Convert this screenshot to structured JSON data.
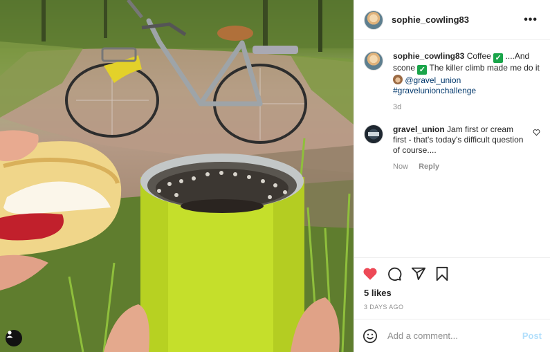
{
  "header": {
    "username": "sophie_cowling83",
    "more_label": "•••"
  },
  "caption": {
    "username": "sophie_cowling83",
    "text_1": "Coffee",
    "text_2": "....And scone",
    "text_3": "The killer climb made me do it",
    "mention": "@gravel_union",
    "hashtag": "#gravelunionchallenge",
    "time": "3d"
  },
  "comments": [
    {
      "username": "gravel_union",
      "text": "Jam first or cream first - that's today's difficult question of course....",
      "time": "Now",
      "reply_label": "Reply"
    }
  ],
  "likes": "5 likes",
  "date": "3 DAYS AGO",
  "comment_input": {
    "placeholder": "Add a comment...",
    "post_label": "Post"
  },
  "icons": {
    "like": "heart-filled-icon",
    "comment": "comment-bubble-icon",
    "share": "paper-plane-icon",
    "save": "bookmark-icon",
    "emoji": "emoji-smile-icon",
    "user_tag": "user-tag-icon",
    "comment_like": "heart-outline-icon"
  },
  "colors": {
    "like": "#ed4956",
    "link": "#00376b",
    "post_disabled": "#b2dffc",
    "check": "#1aa54a"
  }
}
